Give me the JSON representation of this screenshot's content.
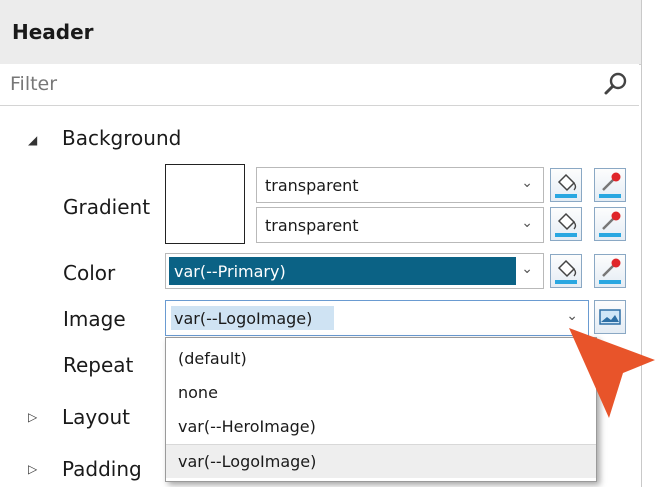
{
  "header": {
    "title": "Header"
  },
  "filter": {
    "placeholder": "Filter"
  },
  "tree": {
    "background_label": "Background",
    "layout_label": "Layout",
    "padding_label": "Padding"
  },
  "props": {
    "gradient_label": "Gradient",
    "gradient_start": "transparent",
    "gradient_end": "transparent",
    "color_label": "Color",
    "color_value": "var(--Primary)",
    "image_label": "Image",
    "image_value": "var(--LogoImage)",
    "repeat_label": "Repeat"
  },
  "dropdown": {
    "options": [
      "(default)",
      "none",
      "var(--HeroImage)",
      "var(--LogoImage)"
    ],
    "selected": "var(--LogoImage)"
  },
  "colors": {
    "accent": "#0b6285",
    "highlight": "#cfe3f3",
    "pointer": "#e8542a"
  }
}
